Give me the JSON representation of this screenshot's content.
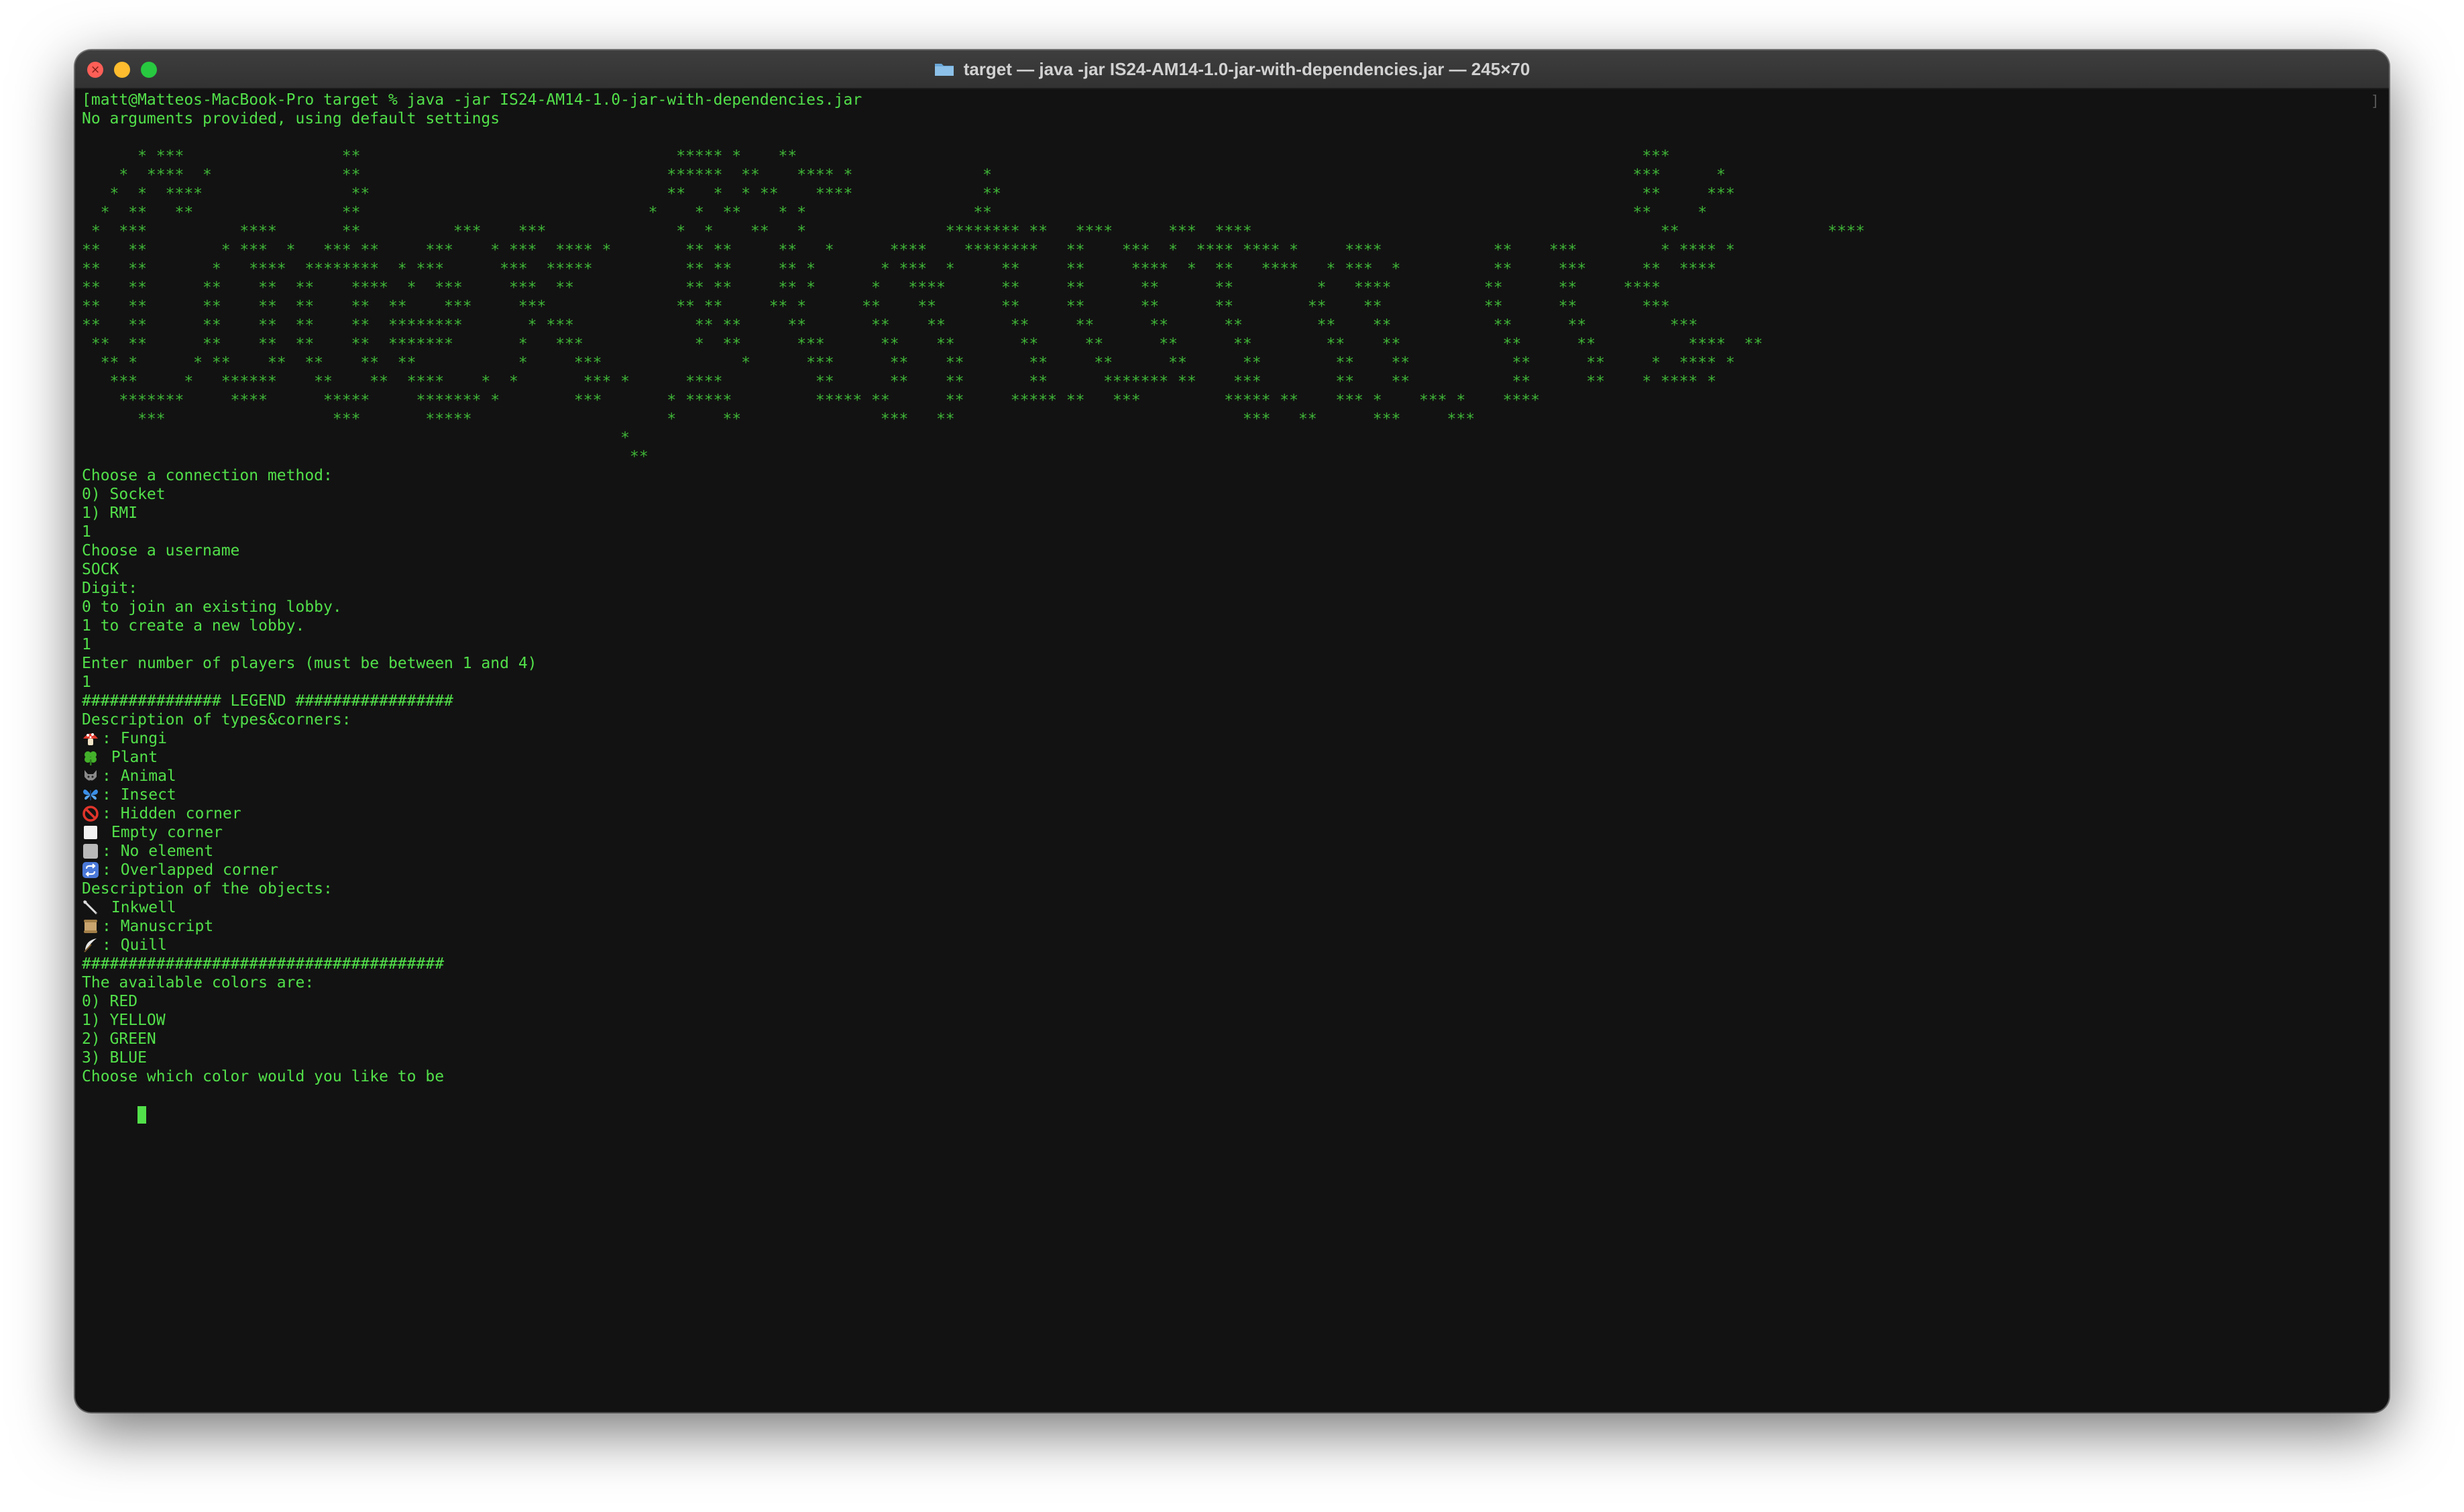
{
  "window": {
    "title": "target — java -jar IS24-AM14-1.0-jar-with-dependencies.jar — 245×70"
  },
  "terminal": {
    "prompt_line": "[matt@Matteos-MacBook-Pro target % java -jar IS24-AM14-1.0-jar-with-dependencies.jar",
    "scroll_marker": "]",
    "no_args": "No arguments provided, using default settings",
    "banner": [
      "      * ***                 **                                  ***** *    **                                                                                           ***",
      "    *  ****  *              **                                 ******  **    **** *              *                                                                     ***      *",
      "   *  *  ****                **                                **   *  * **    ****              **                                                                     **     ***",
      "  *  **   **                **                               *    *  **    * *                  **                                                                     **     *",
      " *  ***          ****       **          ***    ***              *  *    **   *               ******** **   ****      ***  ****                                            **                ****",
      "**   **        * ***  *   *** **     ***    * ***  **** *        ** **     **   *      ****    ********   **    ***  *  **** **** *     ****            **    ***         * **** *",
      "**   **       *   ****  ********  * ***      ***  *****          ** **     ** *       * ***  *     **     **     ****  *  **   ****   * ***  *          **     ***      **  ****",
      "**   **      **    **  **    ****  *  ***     ***  **            ** **     ** *      *   ****      **     **      **      **         *   ****          **      **     ****",
      "**   **      **    **  **    **  **    ***     ***              ** **     ** *      **    **       **     **      **      **        **    **           **      **       ***",
      "**   **      **    **  **    **  ********       * ***             ** **     **       **    **       **     **      **      **        **    **           **      **         ***",
      " **  **      **    **  **    **  *******       *   ***            *  **      ***      **    **       **     **      **      **        **    **           **      **          ****  **",
      "  ** *      * **    **  **    **  **           *     ***               *      ***      **    **       **     **      **      **        **    **           **      **     *  **** *",
      "   ***     *   ******    **    **  ****    *  *       *** *      ****          **      **    **       **      ******* **    ***        **    **           **      **    * **** *",
      "    *******     ****      *****     ******* *        ***       * *****         ***** **      **     ***** **   ***         ***** **    *** *    *** *    ****",
      "      ***                  ***       *****                     *     **               ***   **                               ***   **      ***     ***",
      "                                                          *",
      "                                                           **"
    ],
    "lines": [
      "Choose a connection method:",
      "0) Socket",
      "1) RMI",
      "1",
      "Choose a username",
      "SOCK",
      "Digit:",
      "0 to join an existing lobby.",
      "1 to create a new lobby.",
      "1",
      "Enter number of players (must be between 1 and 4)",
      "1",
      "############### LEGEND #################",
      "Description of types&corners:"
    ],
    "legend_types": [
      {
        "icon": "mushroom-icon",
        "text": ": Fungi"
      },
      {
        "icon": "clover-icon",
        "text": " Plant"
      },
      {
        "icon": "wolf-icon",
        "text": ": Animal"
      },
      {
        "icon": "butterfly-icon",
        "text": ": Insect"
      },
      {
        "icon": "prohibited-icon",
        "text": ": Hidden corner"
      },
      {
        "icon": "white-square-icon",
        "text": " Empty corner"
      },
      {
        "icon": "gray-square-icon",
        "text": ": No element"
      },
      {
        "icon": "repeat-icon",
        "text": ": Overlapped corner"
      }
    ],
    "objects_header": "Description of the objects:",
    "legend_objects": [
      {
        "icon": "inkwell-icon",
        "text": " Inkwell"
      },
      {
        "icon": "scroll-icon",
        "text": ": Manuscript"
      },
      {
        "icon": "feather-icon",
        "text": ": Quill"
      }
    ],
    "after_lines": [
      "#######################################",
      "The available colors are:",
      "0) RED",
      "1) YELLOW",
      "2) GREEN",
      "3) BLUE",
      "Choose which color would you like to be"
    ],
    "colors": {
      "text": "#52e04a",
      "background": "#121212"
    }
  }
}
